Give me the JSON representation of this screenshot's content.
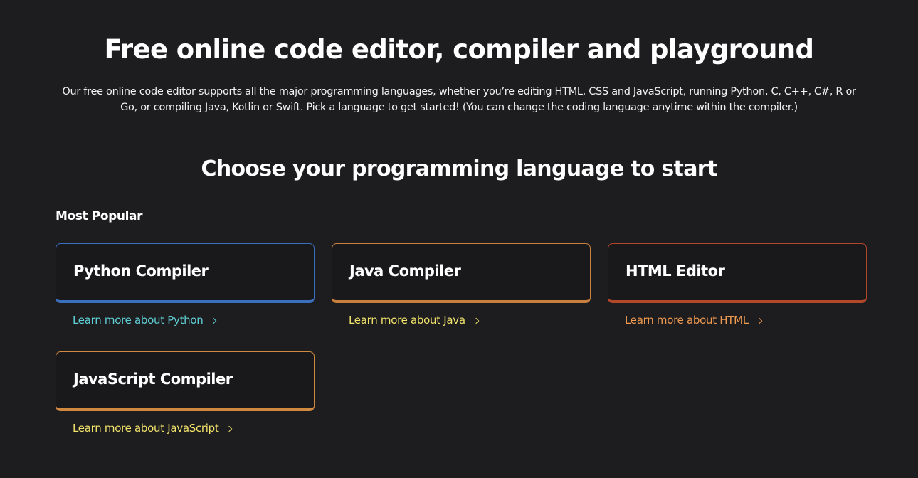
{
  "hero": {
    "title": "Free online code editor, compiler and playground",
    "description": "Our free online code editor supports all the major programming languages, whether you’re editing HTML, CSS and JavaScript, running Python, C, C++, C#, R or Go, or compiling Java, Kotlin or Swift. Pick a language to get started! (You can change the coding language anytime within the compiler.)"
  },
  "section": {
    "title": "Choose your programming language to start",
    "group_title": "Most Popular"
  },
  "cards": [
    {
      "label": "Python Compiler",
      "link": "Learn more about Python",
      "border_color": "#3a6fbe",
      "link_color": "#5fd1d6"
    },
    {
      "label": "Java Compiler",
      "link": "Learn more about Java",
      "border_color": "#c9803e",
      "link_color": "#f2e36a"
    },
    {
      "label": "HTML Editor",
      "link": "Learn more about HTML",
      "border_color": "#b3472a",
      "link_color": "#f09a4f"
    },
    {
      "label": "JavaScript Compiler",
      "link": "Learn more about JavaScript",
      "border_color": "#d08a40",
      "link_color": "#f2e36a"
    }
  ],
  "icons": {
    "link_chevron": "chevron-right-icon"
  }
}
